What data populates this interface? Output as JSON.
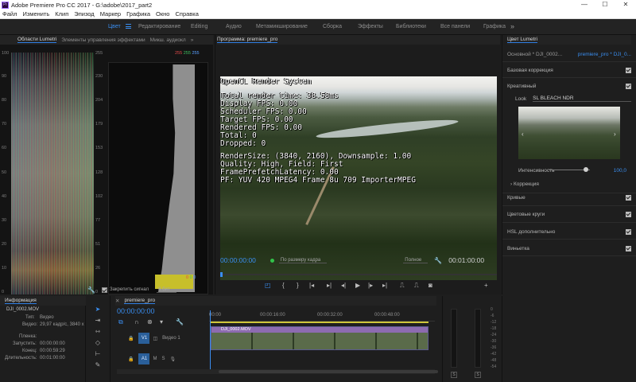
{
  "window": {
    "title": "Adobe Premiere Pro CC 2017 - G:\\adobe\\2017_part2",
    "app_icon": "Pr",
    "controls": [
      "—",
      "☐",
      "✕"
    ]
  },
  "menu": [
    "Файл",
    "Изменить",
    "Клип",
    "Эпизод",
    "Маркер",
    "Графика",
    "Окно",
    "Справка"
  ],
  "workspaces": {
    "items": [
      "Цвет",
      "Редактирование",
      "Editing",
      "Аудио",
      "Метамикширование",
      "Сборка",
      "Эффекты",
      "Библиотеки",
      "Все панели",
      "Графика"
    ],
    "active": "Цвет",
    "more": "»"
  },
  "scopes_panel": {
    "tabs": [
      "Области Lumetri",
      "Элементы управления эффектами",
      "Микш. аудиокл"
    ],
    "more": "»",
    "left_scale": [
      "100",
      "90",
      "80",
      "70",
      "60",
      "50",
      "40",
      "30",
      "20",
      "10",
      "0"
    ],
    "right_scale": [
      "255",
      "230",
      "204",
      "179",
      "153",
      "128",
      "102",
      "77",
      "51",
      "26",
      "0"
    ],
    "hist_top": {
      "r": "255",
      "g": "255",
      "b": "255"
    },
    "hist_bottom": {
      "r": "0",
      "g": "0",
      "b": "0"
    },
    "clamp_label": "Закрепить сигнал",
    "bit_depth": "8 бит"
  },
  "program": {
    "title": "Программа: premiere_pro",
    "overlay_lines": [
      "OpenCL Render System",
      "Total render time: 38.58ms",
      "Display FPS: 0.00",
      "Scheduler FPS: 0.00",
      "Target FPS: 0.00",
      "Rendered FPS: 0.00",
      "Total: 0",
      "Dropped: 0",
      "RenderSize: (3840, 2160), Downsample: 1.00",
      "Quality: High, Field: First",
      "FramePrefetchLatency: 0.00",
      "PF: YUV 420 MPEG4 Frame 8u 709 ImporterMPEG"
    ],
    "timecode_current": "00:00:00:00",
    "fit": "По размеру кадра",
    "quality": "Полное",
    "timecode_duration": "00:01:00:00"
  },
  "lumetri": {
    "header": "Цвет Lumetri",
    "source_master": "Основной * DJI_0002...",
    "source_sequence": "premiere_pro * DJI_0...",
    "sections": {
      "basic": "Базовая коррекция",
      "creative": "Креативный",
      "look_label": "Look",
      "look_value": "SL BLEACH NDR",
      "intensity_label": "Интенсивность",
      "intensity_value": "100,0",
      "adjust": "Коррекция",
      "curves": "Кривые",
      "wheels": "Цветовые круги",
      "hsl": "HSL дополнительно",
      "vignette": "Виньетка"
    },
    "intensity_fraction": 0.9
  },
  "info": {
    "tab": "Информация",
    "filename": "DJI_0002.MOV",
    "type_label": "Тип:",
    "type_value": "Видео",
    "video_label": "Видео:",
    "video_value": "29,97 кадр/с, 3840 x",
    "tape_label": "Пленка:",
    "start_label": "Запустить:",
    "start_value": "00:00:00:00",
    "end_label": "Конец:",
    "end_value": "00:00:59:29",
    "dur_label": "Длительность:",
    "dur_value": "00:01:00:00"
  },
  "timeline": {
    "tab": "premiere_pro",
    "timecode": "00:00:00:00",
    "ruler": [
      "00:00",
      "00:00:16:00",
      "00:00:32:00",
      "00:00:48:00"
    ],
    "clip_name": "DJI_0002.MOV",
    "video_track": "V1",
    "video_track_name": "Видео 1",
    "audio_track": "A1"
  },
  "meters": {
    "scale": [
      "0",
      "-6",
      "-12",
      "-18",
      "-24",
      "-30",
      "-36",
      "-42",
      "-48",
      "-54"
    ],
    "solo": [
      "S",
      "S"
    ]
  }
}
